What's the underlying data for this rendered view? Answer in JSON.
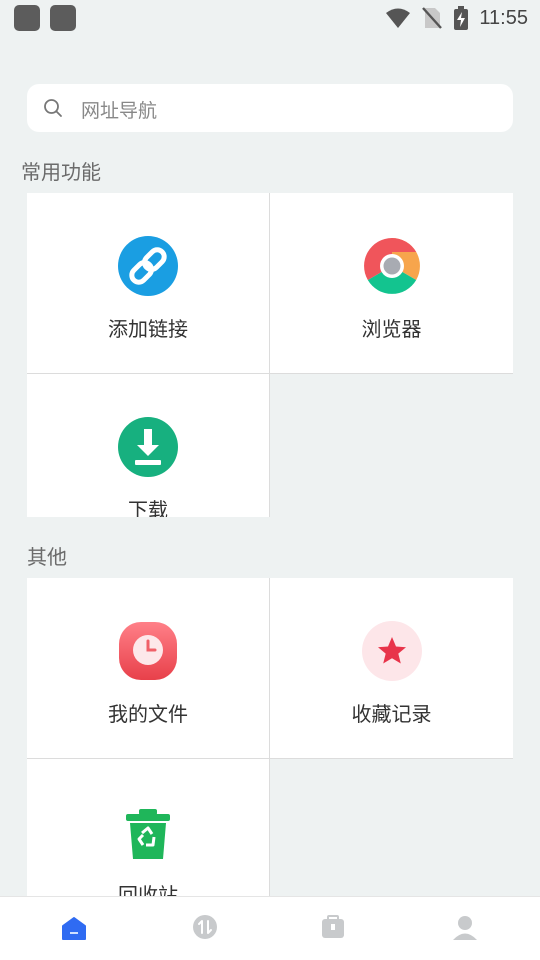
{
  "status_bar": {
    "time": "11:55"
  },
  "search": {
    "placeholder": "网址导航"
  },
  "sections": {
    "common": {
      "title": "常用功能",
      "items": [
        {
          "label": "添加链接",
          "icon": "link-icon",
          "color": "#1a9ee2"
        },
        {
          "label": "浏览器",
          "icon": "chrome-icon"
        },
        {
          "label": "下载",
          "icon": "download-icon",
          "color": "#17b07f"
        }
      ]
    },
    "other": {
      "title": "其他",
      "items": [
        {
          "label": "我的文件",
          "icon": "clock-icon",
          "color": "#f4575f"
        },
        {
          "label": "收藏记录",
          "icon": "star-icon",
          "color": "#e8344a"
        },
        {
          "label": "回收站",
          "icon": "recycle-bin-icon",
          "color": "#1fb65a"
        }
      ]
    }
  },
  "bottom_nav": {
    "active_color": "#2f6bf2",
    "inactive_color": "#c8cacc",
    "items": [
      {
        "icon": "home-icon"
      },
      {
        "icon": "transfer-icon"
      },
      {
        "icon": "toolbox-icon"
      },
      {
        "icon": "profile-icon"
      }
    ]
  }
}
